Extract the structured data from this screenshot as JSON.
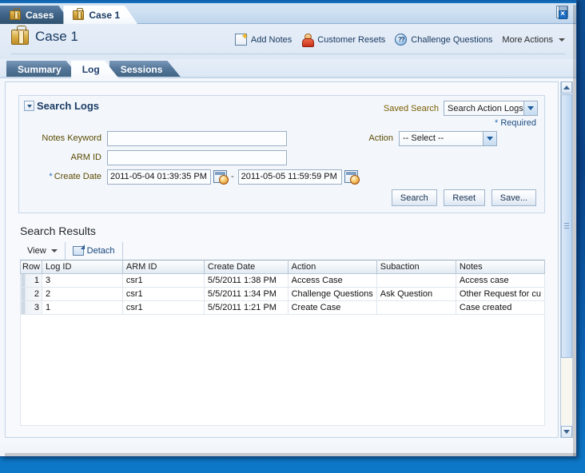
{
  "window": {
    "top_tabs": [
      {
        "label": "Cases",
        "icon": "case-icon",
        "active": false
      },
      {
        "label": "Case 1",
        "icon": "case-icon",
        "active": true
      }
    ],
    "top_right_icon": "save-and-close-icon"
  },
  "case_header": {
    "icon": "briefcase-icon",
    "title": "Case 1",
    "actions": [
      {
        "label": "Add Notes",
        "icon": "add-note-icon"
      },
      {
        "label": "Customer Resets",
        "icon": "person-icon"
      },
      {
        "label": "Challenge Questions",
        "icon": "challenge-questions-icon"
      },
      {
        "label": "More Actions",
        "icon": "chevron-down-icon"
      }
    ]
  },
  "sub_tabs": [
    {
      "label": "Summary",
      "active": false
    },
    {
      "label": "Log",
      "active": true
    },
    {
      "label": "Sessions",
      "active": false
    }
  ],
  "search_panel": {
    "title": "Search Logs",
    "disclosure_icon": "chevron-down-icon",
    "saved_search_label": "Saved Search",
    "saved_search_value": "Search Action Logs",
    "required_note": "Required",
    "required_star": "*",
    "fields": {
      "notes_keyword_label": "Notes Keyword",
      "notes_keyword_value": "",
      "arm_id_label": "ARM ID",
      "arm_id_value": "",
      "create_date_label": "Create Date",
      "create_date_from": "2011-05-04 01:39:35 PM",
      "create_date_to": "2011-05-05 11:59:59 PM",
      "date_range_separator": "-",
      "calendar_icon": "calendar-picker-icon",
      "action_label": "Action",
      "action_value": "-- Select --"
    },
    "buttons": {
      "search": "Search",
      "reset": "Reset",
      "save": "Save..."
    }
  },
  "results": {
    "title": "Search Results",
    "toolbar": {
      "view_label": "View",
      "view_caret": "chevron-down-icon",
      "detach_label": "Detach",
      "detach_icon": "detach-icon"
    },
    "columns": [
      "Row",
      "Log ID",
      "ARM ID",
      "Create Date",
      "Action",
      "Subaction",
      "Notes"
    ],
    "rows": [
      {
        "row": "1",
        "log_id": "3",
        "arm_id": "csr1",
        "create_date": "5/5/2011 1:38 PM",
        "action": "Access Case",
        "subaction": "",
        "notes": "Access case"
      },
      {
        "row": "2",
        "log_id": "2",
        "arm_id": "csr1",
        "create_date": "5/5/2011 1:34 PM",
        "action": "Challenge Questions",
        "subaction": "Ask Question",
        "notes": "Other Request for cu"
      },
      {
        "row": "3",
        "log_id": "1",
        "arm_id": "csr1",
        "create_date": "5/5/2011 1:21 PM",
        "action": "Create Case",
        "subaction": "",
        "notes": "Case created"
      }
    ]
  },
  "scrollbar": {
    "up_arrow_icon": "chevron-up-icon",
    "down_arrow_icon": "chevron-down-icon"
  },
  "colors": {
    "accent_blue": "#1a3a62",
    "label_gold": "#5b4a00",
    "link_blue": "#14457c",
    "desktop_blue": "#0d4d92"
  }
}
